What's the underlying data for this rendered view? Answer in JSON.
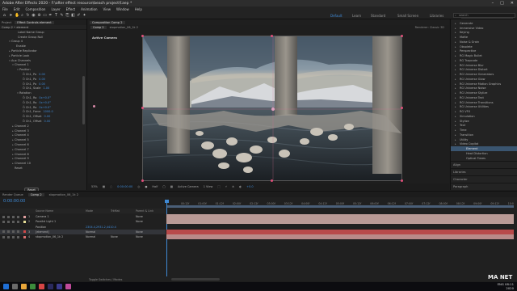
{
  "window": {
    "title": "Adobe After Effects 2020 - F:\\after effect resource\\beach project\\f.aep *"
  },
  "menu": [
    "File",
    "Edit",
    "Composition",
    "Layer",
    "Effect",
    "Animation",
    "View",
    "Window",
    "Help"
  ],
  "workspaces": {
    "default": "Default",
    "learn": "Learn",
    "standard": "Standard",
    "small_screen": "Small Screen",
    "libraries": "Libraries"
  },
  "search_help": {
    "placeholder": "Search Help"
  },
  "left_panel": {
    "tabs": {
      "project": "Project",
      "effect_controls": "Effect Controls element"
    },
    "subheader": "Comp 2 • element",
    "rows": [
      {
        "indent": 18,
        "tri": "",
        "label": "Label Name Group",
        "val": ""
      },
      {
        "indent": 18,
        "tri": "",
        "label": "Create Group Null",
        "val": ""
      },
      {
        "indent": 10,
        "tri": "▾",
        "label": "Group 4",
        "val": ""
      },
      {
        "indent": 16,
        "tri": "",
        "label": "Enable",
        "val": ""
      },
      {
        "indent": 10,
        "tri": "▸",
        "label": "Particle Replicator",
        "val": ""
      },
      {
        "indent": 10,
        "tri": "▸",
        "label": "Particle Look",
        "val": ""
      },
      {
        "indent": 10,
        "tri": "▾",
        "label": "Aux Channels",
        "val": ""
      },
      {
        "indent": 14,
        "tri": "▾",
        "label": "Channel 1",
        "val": ""
      },
      {
        "indent": 20,
        "tri": "▾",
        "label": "Position",
        "val": ""
      },
      {
        "indent": 24,
        "tri": "",
        "label": "Ö Ch1, Po",
        "val": "0.00"
      },
      {
        "indent": 24,
        "tri": "",
        "label": "Ö Ch1, Po",
        "val": "0.00"
      },
      {
        "indent": 24,
        "tri": "",
        "label": "Ö Ch1, Po",
        "val": "0.00"
      },
      {
        "indent": 24,
        "tri": "",
        "label": "Ö Ch1, Scale",
        "val": "1.00"
      },
      {
        "indent": 20,
        "tri": "▾",
        "label": "Rotation",
        "val": ""
      },
      {
        "indent": 24,
        "tri": "",
        "label": "Ö Ch1, Ro",
        "val": "0x+0.0°"
      },
      {
        "indent": 24,
        "tri": "",
        "label": "Ö Ch1, Ro",
        "val": "0x+0.0°"
      },
      {
        "indent": 24,
        "tri": "",
        "label": "Ö Ch1, Ro",
        "val": "0x+0.0°"
      },
      {
        "indent": 24,
        "tri": "",
        "label": "Ö Ch1, Force",
        "val": "1000.0"
      },
      {
        "indent": 24,
        "tri": "",
        "label": "Ö Ch1, Offset",
        "val": "0.00"
      },
      {
        "indent": 24,
        "tri": "",
        "label": "Ö Ch1, Offset",
        "val": "0.00"
      },
      {
        "indent": 14,
        "tri": "▸",
        "label": "Channel 2",
        "val": ""
      },
      {
        "indent": 14,
        "tri": "▸",
        "label": "Channel 3",
        "val": ""
      },
      {
        "indent": 14,
        "tri": "▸",
        "label": "Channel 4",
        "val": ""
      },
      {
        "indent": 14,
        "tri": "▸",
        "label": "Channel 5",
        "val": ""
      },
      {
        "indent": 14,
        "tri": "▸",
        "label": "Channel 6",
        "val": ""
      },
      {
        "indent": 14,
        "tri": "▸",
        "label": "Channel 7",
        "val": ""
      },
      {
        "indent": 14,
        "tri": "▸",
        "label": "Channel 8",
        "val": ""
      },
      {
        "indent": 14,
        "tri": "▸",
        "label": "Channel 9",
        "val": ""
      },
      {
        "indent": 14,
        "tri": "▸",
        "label": "Channel 10",
        "val": ""
      },
      {
        "indent": 14,
        "tri": "",
        "label": "Reset",
        "val": ""
      }
    ],
    "reset_button": "Reset",
    "bottom_rows": [
      {
        "indent": 10,
        "tri": "▾",
        "label": "Group Utilities"
      },
      {
        "indent": 16,
        "tri": "",
        "label": "Copy/Paste Group"
      },
      {
        "indent": 16,
        "tri": "",
        "label": "Create Group Null"
      }
    ]
  },
  "viewer": {
    "panel_tab": "Composition Comp 2",
    "comp_tabs": {
      "comp2": "Comp 2",
      "stopmotion": "stopmotion_06_1k 2"
    },
    "renderer": "Renderer: Classic 3D",
    "active_camera": "Active Camera",
    "controls": {
      "zoom": "53%",
      "timecode": "0:00:00:00",
      "resolution": "Half",
      "camera": "Active Camera",
      "views": "1 View",
      "exposure": "+0.0"
    }
  },
  "right_panel": {
    "search_placeholder": "search",
    "categories": [
      {
        "label": "Generate",
        "indent": false,
        "hl": false
      },
      {
        "label": "Immersive Video",
        "indent": false,
        "hl": false
      },
      {
        "label": "Keying",
        "indent": false,
        "hl": false
      },
      {
        "label": "Matte",
        "indent": false,
        "hl": false
      },
      {
        "label": "Noise & Grain",
        "indent": false,
        "hl": false
      },
      {
        "label": "Obsolete",
        "indent": false,
        "hl": false
      },
      {
        "label": "Perspective",
        "indent": false,
        "hl": false
      },
      {
        "label": "RG Magic Bullet",
        "indent": false,
        "hl": false
      },
      {
        "label": "RG Trapcode",
        "indent": false,
        "hl": false
      },
      {
        "label": "RG Universe Blur",
        "indent": false,
        "hl": false
      },
      {
        "label": "RG Universe Distort",
        "indent": false,
        "hl": false
      },
      {
        "label": "RG Universe Generators",
        "indent": false,
        "hl": false
      },
      {
        "label": "RG Universe Glow",
        "indent": false,
        "hl": false
      },
      {
        "label": "RG Universe Motion Graphics",
        "indent": false,
        "hl": false
      },
      {
        "label": "RG Universe Noise",
        "indent": false,
        "hl": false
      },
      {
        "label": "RG Universe Stylize",
        "indent": false,
        "hl": false
      },
      {
        "label": "RG Universe Text",
        "indent": false,
        "hl": false
      },
      {
        "label": "RG Universe Transitions",
        "indent": false,
        "hl": false
      },
      {
        "label": "RG Universe Utilities",
        "indent": false,
        "hl": false
      },
      {
        "label": "RG VFX",
        "indent": false,
        "hl": false
      },
      {
        "label": "Simulation",
        "indent": false,
        "hl": false
      },
      {
        "label": "Stylize",
        "indent": false,
        "hl": false
      },
      {
        "label": "Text",
        "indent": false,
        "hl": false
      },
      {
        "label": "Time",
        "indent": false,
        "hl": false
      },
      {
        "label": "Transition",
        "indent": false,
        "hl": false
      },
      {
        "label": "Utility",
        "indent": false,
        "hl": false
      },
      {
        "label": "Video Copilot",
        "indent": false,
        "hl": false
      },
      {
        "label": "Element",
        "indent": true,
        "hl": true
      },
      {
        "label": "Heat Distortion",
        "indent": true,
        "hl": false
      },
      {
        "label": "Optical Flares",
        "indent": true,
        "hl": false
      }
    ],
    "sections": [
      "Align",
      "Libraries",
      "Character",
      "Paragraph"
    ]
  },
  "timeline": {
    "tabs": {
      "render_queue": "Render Queue",
      "comp2": "Comp 2",
      "stopmotion": "stopmotion_06_1k 2"
    },
    "timecode": "0:00:00:00",
    "columns": {
      "source": "Source Name",
      "mode": "Mode",
      "trkmat": "TrkMat",
      "parent": "Parent & Link"
    },
    "layers": [
      {
        "num": "1",
        "name": "Camera 1",
        "mode": "",
        "trkmat": "",
        "parent": "None",
        "color": "#e0a0a0",
        "track": "#b99a96"
      },
      {
        "num": "2",
        "name": "Parallel Light 1",
        "mode": "",
        "trkmat": "",
        "parent": "None",
        "color": "#e8e098",
        "track": "#b99a96"
      },
      {
        "num": "",
        "name": "Position",
        "mode": "2304.4,2931.2,4410.4",
        "trkmat": "",
        "parent": "",
        "color": "",
        "track": ""
      },
      {
        "num": "3",
        "name": "[element]",
        "mode": "Normal",
        "trkmat": "",
        "parent": "None",
        "color": "#d04848",
        "track": "#b84a4a"
      },
      {
        "num": "4",
        "name": "stopmotion_06_1k 2",
        "mode": "Normal",
        "trkmat": "None",
        "parent": "None",
        "color": "#d87070",
        "track": "#b98a88"
      }
    ],
    "ruler": [
      "00:12f",
      "01:00f",
      "01:12f",
      "02:00f",
      "02:12f",
      "03:00f",
      "03:12f",
      "04:00f",
      "04:12f",
      "05:00f",
      "05:12f",
      "06:00f",
      "06:12f",
      "07:00f",
      "07:12f",
      "08:00f",
      "08:12f",
      "09:00f",
      "09:12f",
      "10:0"
    ],
    "toggle_label": "Toggle Switches / Modes"
  },
  "taskbar": {
    "lang": "ENG",
    "time": "08:11",
    "date": "2020"
  },
  "watermark": "MA NET"
}
